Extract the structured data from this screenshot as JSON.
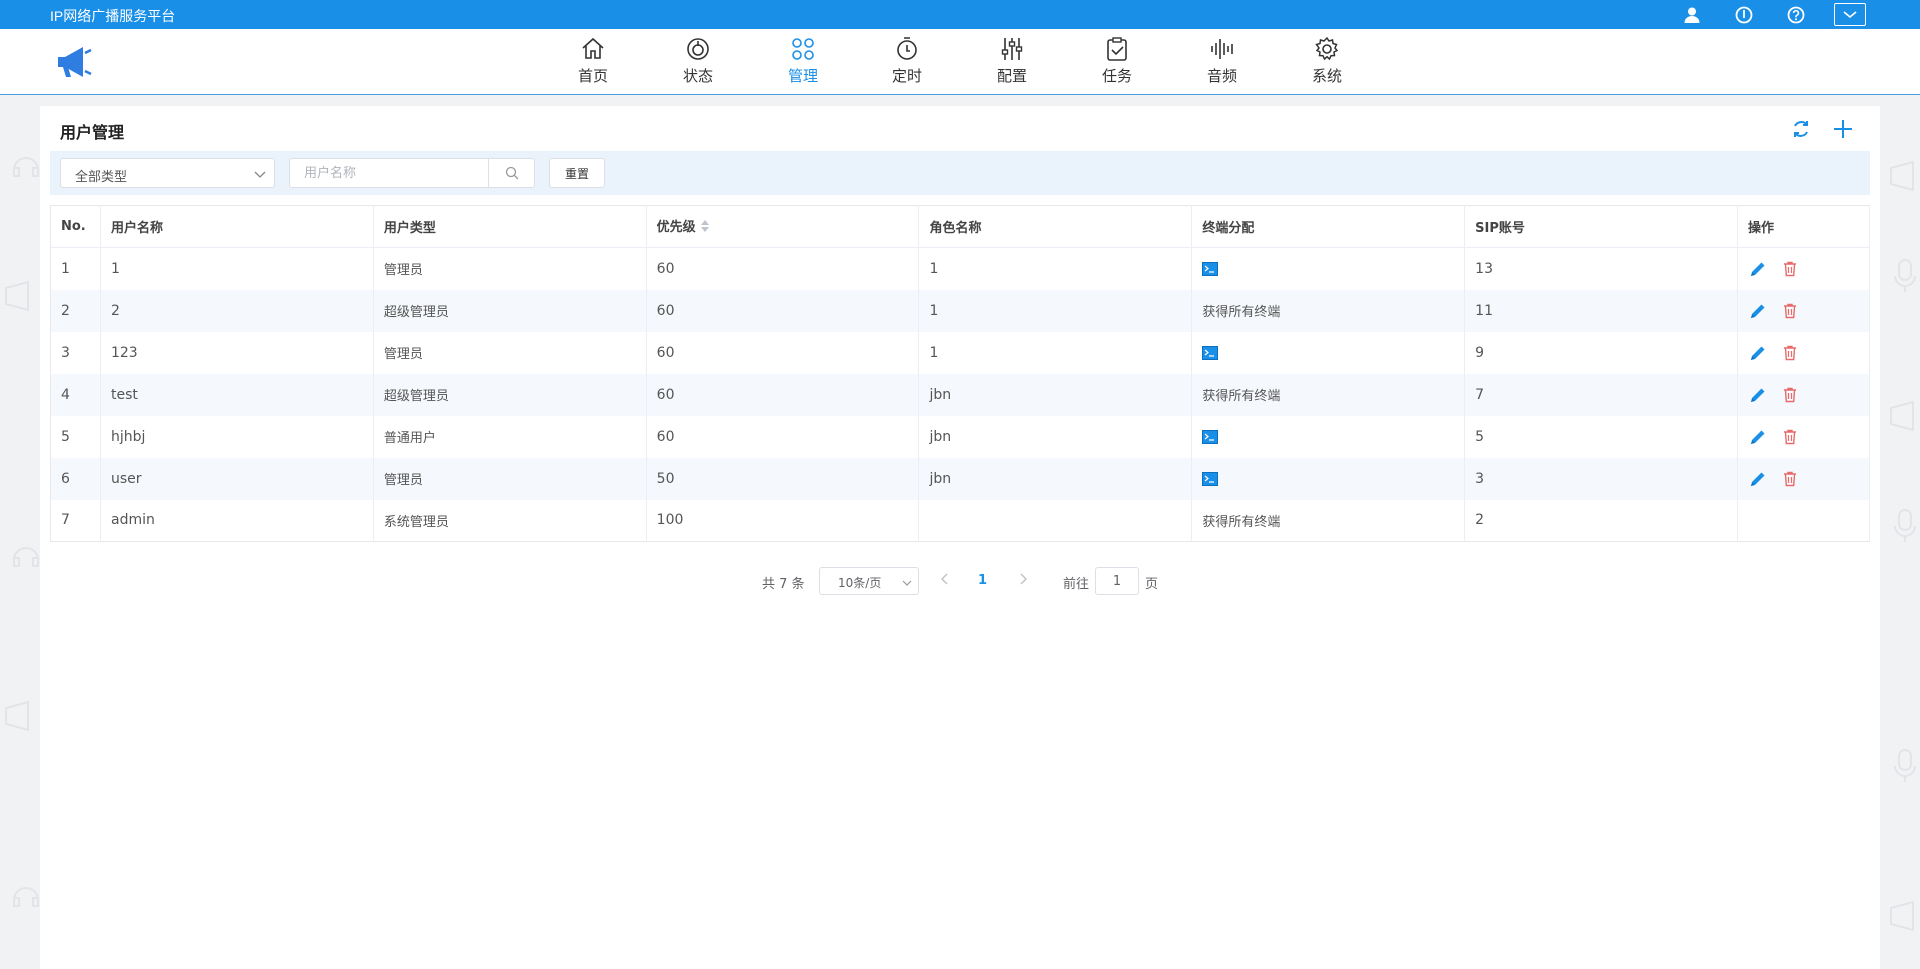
{
  "app": {
    "title": "IP网络广播服务平台",
    "top_icons": [
      "user-icon",
      "power-icon",
      "help-icon",
      "dropdown-toggle-icon"
    ]
  },
  "nav": {
    "items": [
      {
        "label": "首页",
        "icon": "home-icon",
        "active": false
      },
      {
        "label": "状态",
        "icon": "status-icon",
        "active": false
      },
      {
        "label": "管理",
        "icon": "manage-icon",
        "active": true
      },
      {
        "label": "定时",
        "icon": "timer-icon",
        "active": false
      },
      {
        "label": "配置",
        "icon": "sliders-icon",
        "active": false
      },
      {
        "label": "任务",
        "icon": "clipboard-check-icon",
        "active": false
      },
      {
        "label": "音频",
        "icon": "audio-wave-icon",
        "active": false
      },
      {
        "label": "系统",
        "icon": "gear-icon",
        "active": false
      }
    ]
  },
  "page": {
    "title": "用户管理"
  },
  "filters": {
    "type_select": "全部类型",
    "search_placeholder": "用户名称",
    "reset_label": "重置"
  },
  "table": {
    "headers": [
      "No.",
      "用户名称",
      "用户类型",
      "优先级",
      "角色名称",
      "终端分配",
      "SIP账号",
      "操作"
    ],
    "rows": [
      {
        "no": "1",
        "name": "1",
        "type": "管理员",
        "priority": "60",
        "role": "1",
        "terminal": "",
        "terminal_icon": true,
        "sip": "13",
        "ops": true
      },
      {
        "no": "2",
        "name": "2",
        "type": "超级管理员",
        "priority": "60",
        "role": "1",
        "terminal": "获得所有终端",
        "terminal_icon": false,
        "sip": "11",
        "ops": true
      },
      {
        "no": "3",
        "name": "123",
        "type": "管理员",
        "priority": "60",
        "role": "1",
        "terminal": "",
        "terminal_icon": true,
        "sip": "9",
        "ops": true
      },
      {
        "no": "4",
        "name": "test",
        "type": "超级管理员",
        "priority": "60",
        "role": "jbn",
        "terminal": "获得所有终端",
        "terminal_icon": false,
        "sip": "7",
        "ops": true
      },
      {
        "no": "5",
        "name": "hjhbj",
        "type": "普通用户",
        "priority": "60",
        "role": "jbn",
        "terminal": "",
        "terminal_icon": true,
        "sip": "5",
        "ops": true
      },
      {
        "no": "6",
        "name": "user",
        "type": "管理员",
        "priority": "50",
        "role": "jbn",
        "terminal": "",
        "terminal_icon": true,
        "sip": "3",
        "ops": true
      },
      {
        "no": "7",
        "name": "admin",
        "type": "系统管理员",
        "priority": "100",
        "role": "",
        "terminal": "获得所有终端",
        "terminal_icon": false,
        "sip": "2",
        "ops": false
      }
    ]
  },
  "pagination": {
    "total": "共 7 条",
    "page_size": "10条/页",
    "current_page": "1",
    "goto_label": "前往",
    "goto_value": "1",
    "page_suffix": "页"
  },
  "colors": {
    "accent": "#1a8fe8",
    "edit": "#1a8fe8",
    "delete": "#e86a6a",
    "filter_bg": "#eaf3fc"
  }
}
